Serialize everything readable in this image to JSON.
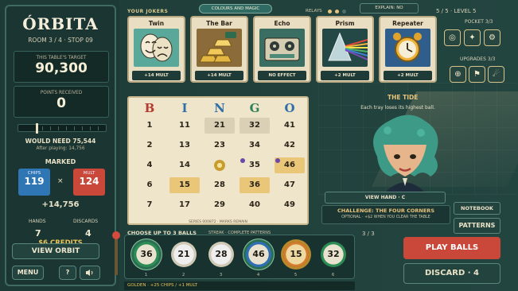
{
  "left_panel": {
    "title": "ÓRBITA",
    "room": "ROOM 3 / 4  ·  STOP 09",
    "target_label": "THIS TABLE'S TARGET",
    "target_value": "90,300",
    "points_label": "POINTS RECEIVED",
    "points_value": "0",
    "would_need": "WOULD NEED 75,544",
    "after_playing": "After playing: 14,756",
    "marked_label": "MARKED",
    "chips_label": "CHIPS",
    "chips_value": "119",
    "times": "×",
    "mult_label": "MULT",
    "mult_value": "124",
    "total": "+14,756",
    "hands_label": "HANDS",
    "hands_value": "7",
    "discards_label": "DISCARDS",
    "discards_value": "4",
    "credits": "$6 CREDITS",
    "view_orbit": "VIEW ORBIT",
    "menu": "MENU",
    "help": "?",
    "sound_icon": "speaker-icon"
  },
  "top": {
    "your_jokers": "YOUR JOKERS",
    "colours_magic": "COLOURS AND MAGIC",
    "relays": "RELAYS",
    "explain": "EXPLAIN: NO",
    "level": "5 / 5  ·  LEVEL 5",
    "pocket_label": "POCKET 3/3",
    "upgrades_label": "UPGRADES 3/3"
  },
  "jokers": [
    {
      "name": "Twin",
      "effect": "+14 MULT",
      "icon": "theatre-masks-icon"
    },
    {
      "name": "The Bar",
      "effect": "+14 MULT",
      "icon": "gold-bars-icon"
    },
    {
      "name": "Echo",
      "effect": "NO EFFECT",
      "icon": "tape-recorder-icon"
    },
    {
      "name": "Prism",
      "effect": "+2 MULT",
      "icon": "prism-icon"
    },
    {
      "name": "Repeater",
      "effect": "+2 MULT",
      "icon": "alarm-clock-icon"
    }
  ],
  "bingo": {
    "letters": [
      "B",
      "I",
      "N",
      "G",
      "O"
    ],
    "letter_colors": [
      "#b53a2e",
      "#2f6fa8",
      "#2f6fa8",
      "#2d7f58",
      "#2f6fa8"
    ],
    "rows": [
      [
        "1",
        "11",
        "21",
        "32",
        "41"
      ],
      [
        "2",
        "13",
        "23",
        "34",
        "42"
      ],
      [
        "4",
        "14",
        "FREE",
        "35",
        "46"
      ],
      [
        "6",
        "15",
        "28",
        "36",
        "47"
      ],
      [
        "7",
        "17",
        "29",
        "40",
        "49"
      ]
    ],
    "footer": "SERIES 000872  ·  MARKS REMAIN"
  },
  "tide": {
    "title": "THE TIDE",
    "desc": "Each tray loses its highest ball."
  },
  "view_hand": "VIEW HAND · C",
  "challenge": {
    "title": "CHALLENGE: THE FOUR CORNERS",
    "desc": "OPTIONAL · +$2 WHEN YOU CLEAR THE TABLE"
  },
  "notebook": "NOTEBOOK",
  "patterns": "PATTERNS",
  "count": "3 / 3",
  "tray": {
    "label": "CHOOSE UP TO 3 BALLS",
    "streak": "STREAK · COMPLETE PATTERNS",
    "balls": [
      "36",
      "21",
      "28",
      "46",
      "15",
      "32"
    ],
    "indices": [
      "1",
      "2",
      "3",
      "4",
      "5",
      "6"
    ]
  },
  "golden": "GOLDEN · +25 CHIPS / +1 MULT",
  "play": "PLAY BALLS",
  "discard": "DISCARD · 4",
  "colors": {
    "accent_red": "#c9483a",
    "accent_blue": "#2f77b4",
    "panel": "#1a3532",
    "gold": "#e9c55a"
  }
}
